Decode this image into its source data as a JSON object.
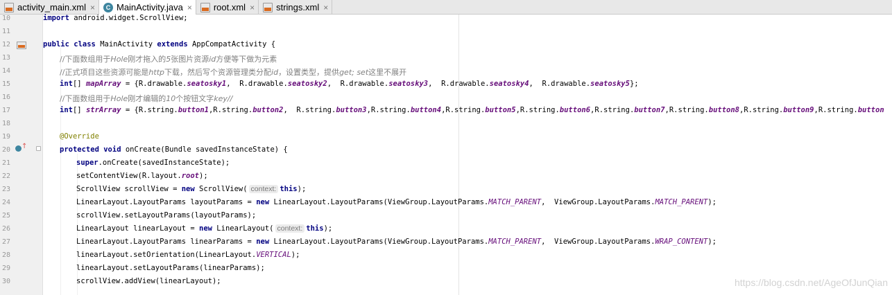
{
  "tabs": [
    {
      "label": "activity_main.xml",
      "icon": "xml-file-icon",
      "active": false
    },
    {
      "label": "MainActivity.java",
      "icon": "java-class-icon",
      "active": true
    },
    {
      "label": "root.xml",
      "icon": "xml-file-icon",
      "active": false
    },
    {
      "label": "strings.xml",
      "icon": "xml-file-icon",
      "active": false
    }
  ],
  "tab_close_glyph": "×",
  "java_icon_letter": "C",
  "line_numbers": [
    "10",
    "11",
    "12",
    "13",
    "14",
    "15",
    "16",
    "17",
    "18",
    "19",
    "20",
    "21",
    "22",
    "23",
    "24",
    "25",
    "26",
    "27",
    "28",
    "29",
    "30"
  ],
  "code": {
    "l10": {
      "kw": "import",
      "rest": " android.widget.ScrollView;"
    },
    "l12": {
      "kw1": "public",
      "kw2": "class",
      "name": "MainActivity",
      "kw3": "extends",
      "rest": "AppCompatActivity {"
    },
    "l13": {
      "a": "//下面数组用于",
      "b": "Hole",
      "c": "刚才拖入的",
      "d": "5",
      "e": "张图片资源",
      "f": "id",
      "g": "方便等下做为元素"
    },
    "l14": {
      "a": "//正式项目这些资源可能是",
      "b": "http",
      "c": "下载，然后写个资源管理类分配",
      "d": "id",
      "e": "，设置类型，提供",
      "f": "get; set",
      "g": "这里不展开"
    },
    "l15": {
      "type": "int",
      "arr": "[]",
      "var": "mapArray",
      "eq": " = {R.drawable.",
      "f1": "seatosky1",
      "s1": ",  R.drawable.",
      "f2": "seatosky2",
      "s2": ",  R.drawable.",
      "f3": "seatosky3",
      "s3": ",  R.drawable.",
      "f4": "seatosky4",
      "s4": ",  R.drawable.",
      "f5": "seatosky5",
      "end": "};"
    },
    "l16": {
      "a": "//下面数组用于",
      "b": "Hole",
      "c": "刚才编辑的",
      "d": "10",
      "e": "个按钮文字",
      "f": "key//"
    },
    "l17": {
      "type": "int",
      "arr": "[]",
      "var": "strArray",
      "eq": " = {R.string.",
      "f1": "button1",
      "s1": ",R.string.",
      "f2": "button2",
      "s2": ",  R.string.",
      "f3": "button3",
      "s3": ",R.string.",
      "f4": "button4",
      "s4": ",R.string.",
      "f5": "button5",
      "s5": ",R.string.",
      "f6": "button6",
      "s6": ",R.string.",
      "f7": "button7",
      "s7": ",R.string.",
      "f8": "button8",
      "s8": ",R.string.",
      "f9": "button9",
      "s9": ",R.string.",
      "f10": "button"
    },
    "l19": {
      "ann": "@Override"
    },
    "l20": {
      "kw1": "protected",
      "kw2": "void",
      "rest": " onCreate(Bundle savedInstanceState) {"
    },
    "l21": {
      "kw": "super",
      "rest": ".onCreate(savedInstanceState);"
    },
    "l22": {
      "a": "setContentView(R.layout.",
      "f": "root",
      "b": ");"
    },
    "l23": {
      "a": "ScrollView scrollView = ",
      "kw": "new",
      "b": " ScrollView(",
      "hint": "context:",
      "kw2": "this",
      "c": ");"
    },
    "l24": {
      "a": "LinearLayout.LayoutParams layoutParams = ",
      "kw": "new",
      "b": " LinearLayout.LayoutParams(ViewGroup.LayoutParams.",
      "c1": "MATCH_PARENT",
      "b2": ",  ViewGroup.LayoutParams.",
      "c2": "MATCH_PARENT",
      "end": ");"
    },
    "l25": {
      "a": "scrollView.setLayoutParams(layoutParams);"
    },
    "l26": {
      "a": "LinearLayout linearLayout = ",
      "kw": "new",
      "b": " LinearLayout(",
      "hint": "context:",
      "kw2": "this",
      "c": ");"
    },
    "l27": {
      "a": "LinearLayout.LayoutParams linearParams = ",
      "kw": "new",
      "b": " LinearLayout.LayoutParams(ViewGroup.LayoutParams.",
      "c1": "MATCH_PARENT",
      "b2": ",  ViewGroup.LayoutParams.",
      "c2": "WRAP_CONTENT",
      "end": ");"
    },
    "l28": {
      "a": "linearLayout.setOrientation(LinearLayout.",
      "c": "VERTICAL",
      "b": ");"
    },
    "l29": {
      "a": "linearLayout.setLayoutParams(linearParams);"
    },
    "l30": {
      "a": "scrollView.addView(linearLayout);"
    }
  },
  "watermark": "https://blog.csdn.net/AgeOfJunQian",
  "colors": {
    "keyword": "#000080",
    "comment": "#808080",
    "field": "#660e7a",
    "annotation": "#808000",
    "gutter": "#f0f0f0",
    "tabbar": "#e8e8e8"
  }
}
